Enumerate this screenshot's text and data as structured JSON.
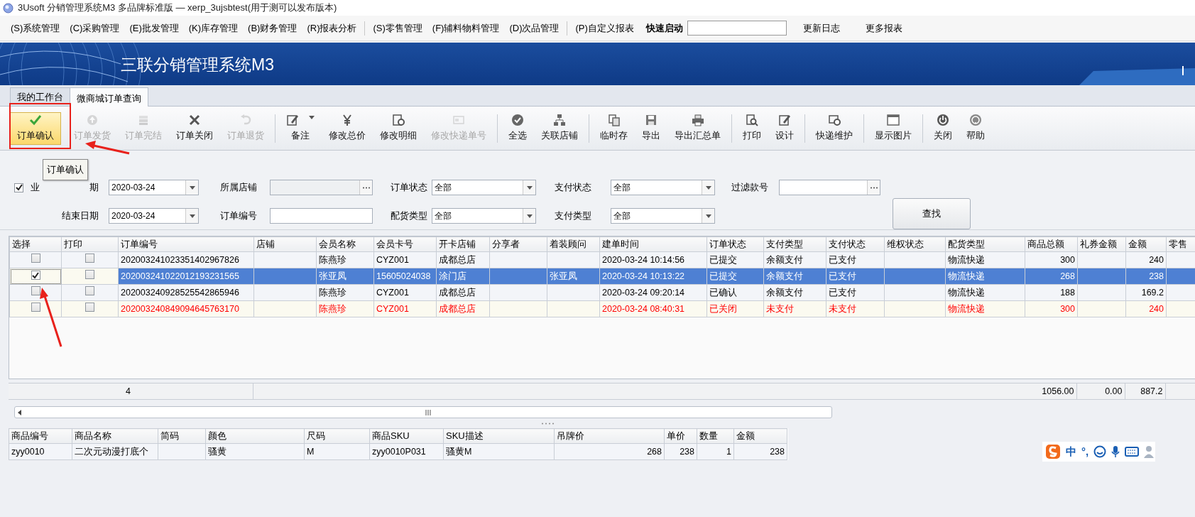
{
  "window": {
    "title": "3Usoft 分销管理系统M3 多品牌标准版 — xerp_3ujsbtest(用于测可以发布版本)"
  },
  "menu": {
    "groups": [
      [
        "(S)系统管理",
        "(C)采购管理",
        "(E)批发管理",
        "(K)库存管理",
        "(B)财务管理",
        "(R)报表分析"
      ],
      [
        "(S)零售管理",
        "(F)辅料物料管理",
        "(D)次品管理"
      ],
      [
        "(P)自定义报表"
      ]
    ],
    "quick_launch": {
      "label": "快速启动"
    },
    "links": [
      "更新日志",
      "更多报表"
    ]
  },
  "banner": {
    "title": "三联分销管理系统M3"
  },
  "tabs": [
    {
      "label": "我的工作台",
      "selected": false
    },
    {
      "label": "微商城订单查询",
      "selected": true
    }
  ],
  "toolbar": {
    "groups": [
      [
        {
          "label": "订单确认",
          "disabled": false,
          "hot": true,
          "dropdown": false
        },
        {
          "label": "订单发货",
          "disabled": true,
          "hot": false,
          "dropdown": false
        },
        {
          "label": "订单完结",
          "disabled": true,
          "hot": false,
          "dropdown": false
        },
        {
          "label": "订单关闭",
          "disabled": false,
          "hot": false,
          "dropdown": false
        },
        {
          "label": "订单退货",
          "disabled": true,
          "hot": false,
          "dropdown": false
        }
      ],
      [
        {
          "label": "备注",
          "disabled": false,
          "hot": false,
          "dropdown": true
        },
        {
          "label": "修改总价",
          "disabled": false,
          "hot": false,
          "dropdown": false
        },
        {
          "label": "修改明细",
          "disabled": false,
          "hot": false,
          "dropdown": false
        },
        {
          "label": "修改快递单号",
          "disabled": true,
          "hot": false,
          "dropdown": false
        }
      ],
      [
        {
          "label": "全选",
          "disabled": false,
          "hot": false,
          "dropdown": false
        },
        {
          "label": "关联店铺",
          "disabled": false,
          "hot": false,
          "dropdown": false
        }
      ],
      [
        {
          "label": "临时存",
          "disabled": false,
          "hot": false,
          "dropdown": false
        },
        {
          "label": "导出",
          "disabled": false,
          "hot": false,
          "dropdown": false
        },
        {
          "label": "导出汇总单",
          "disabled": false,
          "hot": false,
          "dropdown": false
        }
      ],
      [
        {
          "label": "打印",
          "disabled": false,
          "hot": false,
          "dropdown": false
        },
        {
          "label": "设计",
          "disabled": false,
          "hot": false,
          "dropdown": false
        }
      ],
      [
        {
          "label": "快递维护",
          "disabled": false,
          "hot": false,
          "dropdown": false
        }
      ],
      [
        {
          "label": "显示图片",
          "disabled": false,
          "hot": false,
          "dropdown": false
        }
      ],
      [
        {
          "label": "关闭",
          "disabled": false,
          "hot": false,
          "dropdown": false
        },
        {
          "label": "帮助",
          "disabled": false,
          "hot": false,
          "dropdown": false
        }
      ]
    ]
  },
  "tooltip": {
    "text": "订单确认"
  },
  "filters": {
    "business_date": {
      "checked": true,
      "label_start": "业",
      "label_end": "期",
      "value": "2020-03-24"
    },
    "end_date": {
      "label": "结束日期",
      "value": "2020-03-24"
    },
    "store": {
      "label": "所属店铺",
      "disabled": true
    },
    "order_no": {
      "label": "订单编号",
      "disabled": false
    },
    "order_status": {
      "label": "订单状态",
      "value": "全部"
    },
    "delivery_type": {
      "label": "配货类型",
      "value": "全部"
    },
    "pay_status": {
      "label": "支付状态",
      "value": "全部"
    },
    "pay_type": {
      "label": "支付类型",
      "value": "全部"
    },
    "style_no": {
      "label": "过滤款号"
    },
    "search_button": "查找"
  },
  "orders": {
    "checkbox_columns": [
      "选择",
      "打印"
    ],
    "columns": [
      "订单编号",
      "店铺",
      "会员名称",
      "会员卡号",
      "开卡店铺",
      "分享者",
      "着装顾问",
      "建单时间",
      "订单状态",
      "支付类型",
      "支付状态",
      "维权状态",
      "配货类型",
      "商品总额",
      "礼券金额",
      "金额",
      "零售"
    ],
    "rows": [
      {
        "selected": false,
        "checked": false,
        "print": false,
        "closed": false,
        "cells": [
          "202003241023351402967826",
          null,
          "陈燕珍",
          "CYZ001",
          "成都总店",
          null,
          null,
          "2020-03-24 10:14:56",
          "已提交",
          "余额支付",
          "已支付",
          null,
          "物流快递",
          "300",
          null,
          "240",
          null
        ]
      },
      {
        "selected": true,
        "checked": true,
        "print": false,
        "closed": false,
        "cells": [
          "202003241022012193231565",
          null,
          "张亚凤",
          "15605024038",
          "涂门店",
          null,
          "张亚凤",
          "2020-03-24 10:13:22",
          "已提交",
          "余额支付",
          "已支付",
          null,
          "物流快递",
          "268",
          null,
          "238",
          null
        ]
      },
      {
        "selected": false,
        "checked": false,
        "print": false,
        "closed": false,
        "cells": [
          "202003240928525542865946",
          null,
          "陈燕珍",
          "CYZ001",
          "成都总店",
          null,
          null,
          "2020-03-24 09:20:14",
          "已确认",
          "余额支付",
          "已支付",
          null,
          "物流快递",
          "188",
          null,
          "169.2",
          null
        ]
      },
      {
        "selected": false,
        "checked": false,
        "print": false,
        "closed": true,
        "cells": [
          "202003240849094645763170",
          null,
          "陈燕珍",
          "CYZ001",
          "成都总店",
          null,
          null,
          "2020-03-24 08:40:31",
          "已关闭",
          "未支付",
          "未支付",
          null,
          "物流快递",
          "300",
          null,
          "240",
          null
        ]
      }
    ],
    "footer": {
      "count": "4",
      "goods_total": "1056.00",
      "coupon_total": "0.00",
      "amount_total": "887.2"
    }
  },
  "details": {
    "columns": [
      "商品编号",
      "商品名称",
      "简码",
      "颜色",
      "尺码",
      "商品SKU",
      "SKU描述",
      "吊牌价",
      "单价",
      "数量",
      "金额"
    ],
    "rows": [
      {
        "cells": [
          "zyy0010",
          "二次元动漫打底个",
          null,
          "骚黄",
          "M",
          "zyy0010P031",
          "骚黄M",
          "268",
          "238",
          "1",
          "238"
        ]
      }
    ]
  },
  "ime_bar": {
    "mode": "中",
    "punct": "°,"
  }
}
